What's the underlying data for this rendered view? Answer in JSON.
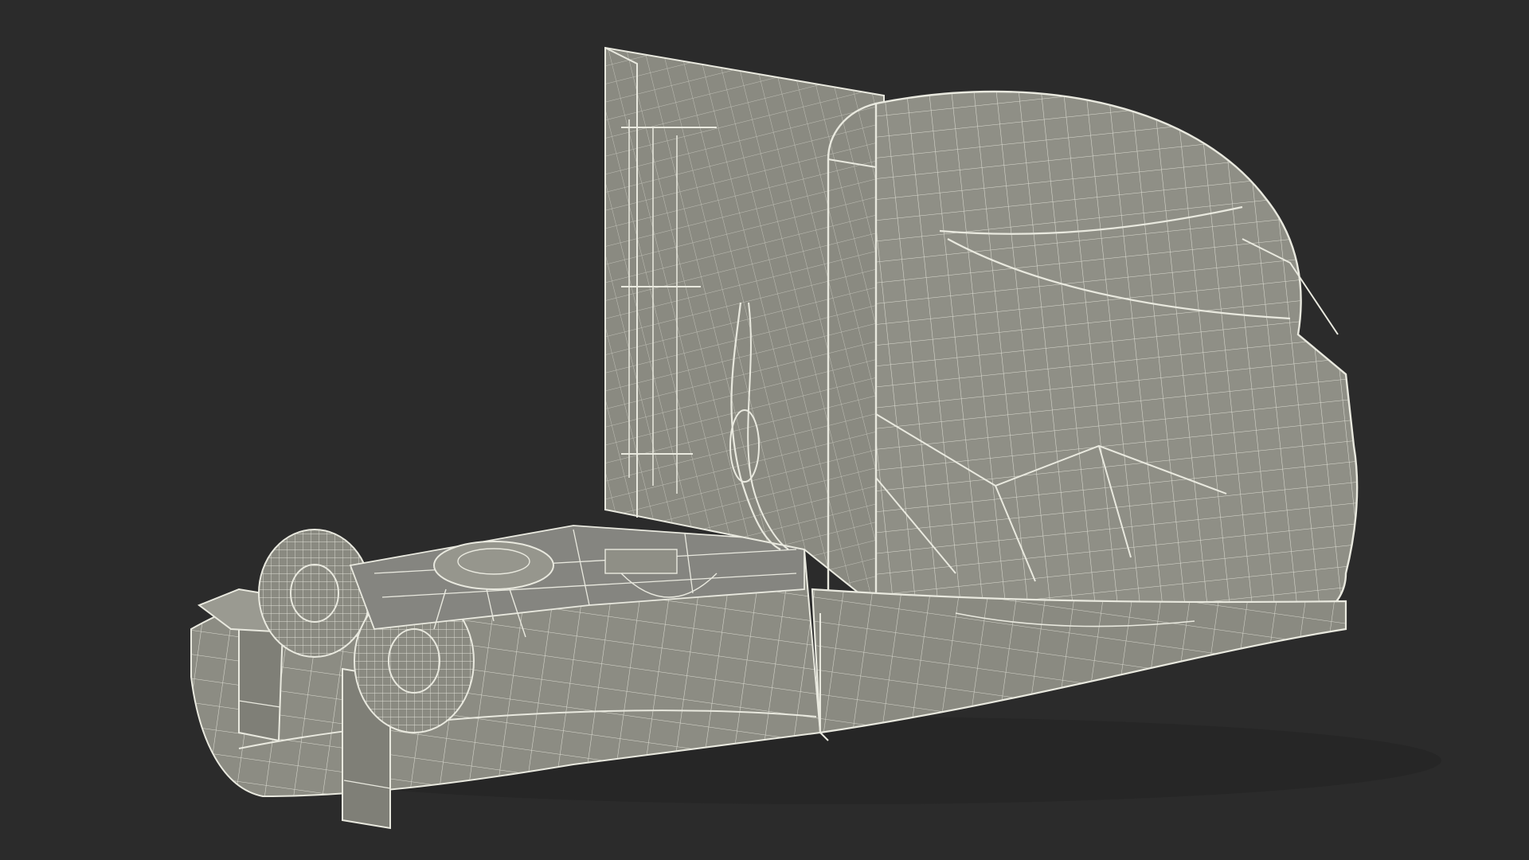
{
  "scene": {
    "subject": "wireframe-semi-truck-tractor",
    "colors": {
      "background": "#2b2b2b",
      "surface": "#8f8f86",
      "surface_dark": "#77776f",
      "surface_light": "#a3a39a",
      "wire": "#e9e9df",
      "shadow": "#1f1f1f"
    }
  }
}
